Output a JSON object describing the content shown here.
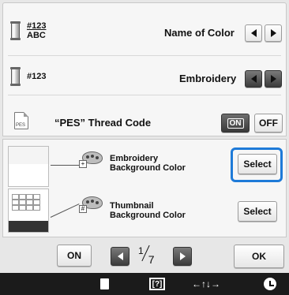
{
  "settings": {
    "row1": {
      "code_top": "#123",
      "code_bottom": "ABC",
      "label": "Name of Color"
    },
    "row2": {
      "code": "#123",
      "label": "Embroidery"
    },
    "row3": {
      "file_icon_text": "PES",
      "label": "“PES” Thread Code",
      "on_label": "ON",
      "off_label": "OFF",
      "state": "ON"
    },
    "row4": {
      "label_line1": "Embroidery",
      "label_line2": "Background Color",
      "select_label": "Select",
      "highlighted": true
    },
    "row5": {
      "label_line1": "Thumbnail",
      "label_line2": "Background Color",
      "select_label": "Select"
    }
  },
  "nav": {
    "on_label": "ON",
    "page_current": "1",
    "page_total": "7",
    "ok_label": "OK"
  },
  "status_bar": {
    "help_text": "[?]",
    "presser_icon_text": "←↑↓→"
  },
  "colors": {
    "highlight": "#1e7ad8",
    "status_bar": "#1b1b1b"
  },
  "icons": [
    "thread-spool-icon",
    "pes-file-icon",
    "palette-icon",
    "arrow-left-icon",
    "arrow-right-icon",
    "document-icon",
    "help-icon",
    "presser-foot-icon",
    "clock-icon"
  ]
}
